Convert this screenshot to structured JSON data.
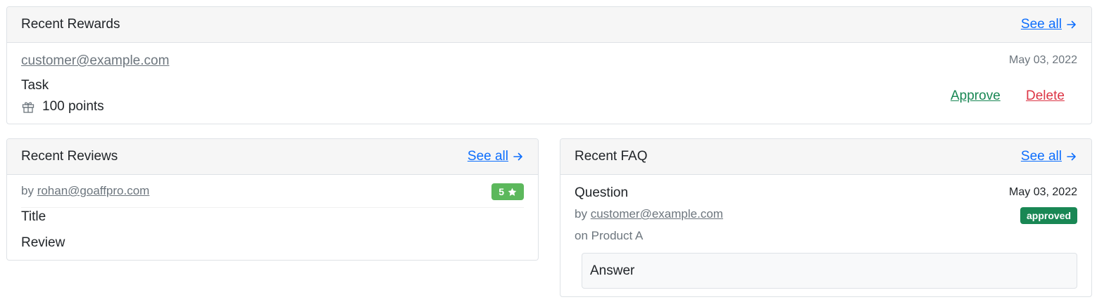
{
  "rewards": {
    "title": "Recent Rewards",
    "see_all": "See all",
    "item": {
      "email": "customer@example.com",
      "date": "May 03, 2022",
      "task": "Task",
      "points": "100 points",
      "approve": "Approve",
      "delete": "Delete"
    }
  },
  "reviews": {
    "title": "Recent Reviews",
    "see_all": "See all",
    "item": {
      "by_prefix": "by",
      "email": "rohan@goaffpro.com",
      "rating": "5",
      "title": "Title",
      "review": "Review"
    }
  },
  "faq": {
    "title": "Recent FAQ",
    "see_all": "See all",
    "item": {
      "question": "Question",
      "date": "May 03, 2022",
      "by_prefix": "by",
      "email": "customer@example.com",
      "status": "approved",
      "product": "on Product A",
      "answer": "Answer"
    }
  },
  "colors": {
    "link": "#0d6efd",
    "approve": "#198754",
    "delete": "#dc3545",
    "rating_badge": "#5cb85c",
    "status_badge": "#198754"
  },
  "icons": [
    "arrow-right-icon",
    "gift-icon",
    "star-icon"
  ]
}
